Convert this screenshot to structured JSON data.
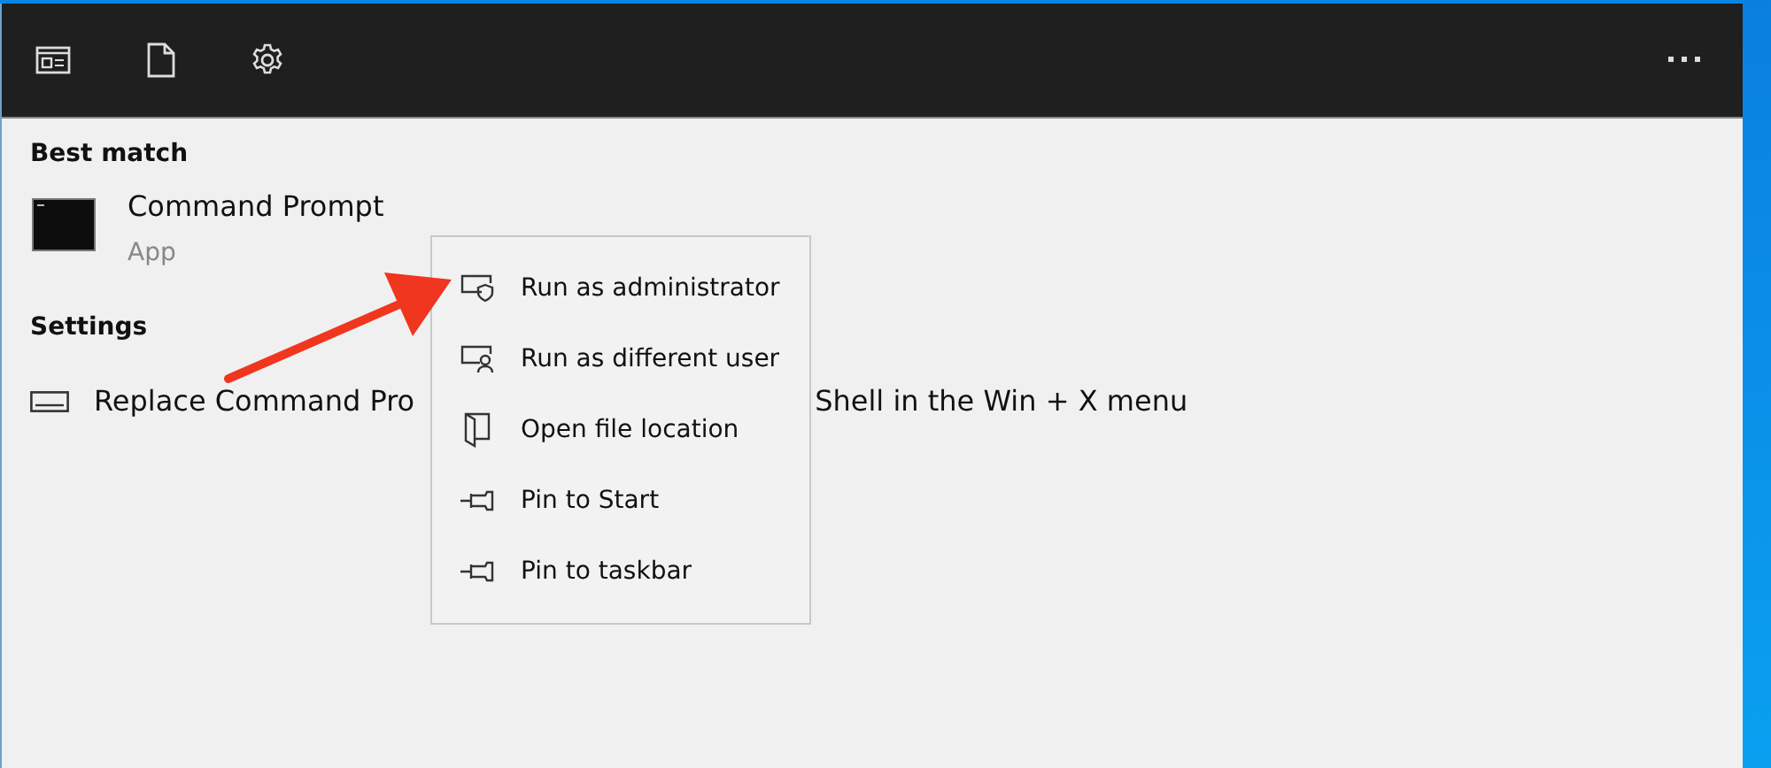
{
  "sections": [
    {
      "heading": "Best match",
      "items": [
        {
          "kind": "app",
          "title": "Command Prompt",
          "subtitle": "App"
        }
      ]
    },
    {
      "heading": "Settings",
      "items": [
        {
          "kind": "setting",
          "text_start": "Replace Command Pro",
          "text_end": "Shell in the Win + X menu"
        }
      ]
    }
  ],
  "context_menu": {
    "items": [
      {
        "kind": "shield",
        "label": "Run as administrator"
      },
      {
        "kind": "user",
        "label": "Run as different user"
      },
      {
        "kind": "folder",
        "label": "Open file location"
      },
      {
        "kind": "pin",
        "label": "Pin to Start"
      },
      {
        "kind": "pin",
        "label": "Pin to taskbar"
      }
    ]
  }
}
